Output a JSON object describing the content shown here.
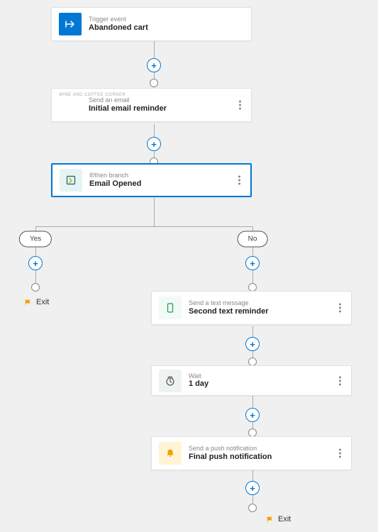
{
  "steps": {
    "trigger": {
      "type": "Trigger event",
      "name": "Abandoned cart"
    },
    "email": {
      "type": "Send an email",
      "name": "Initial email reminder",
      "badge": "WINE AND COFFEE CORNER"
    },
    "branch": {
      "type": "If/then branch",
      "name": "Email Opened"
    },
    "sms": {
      "type": "Send a text message",
      "name": "Second text reminder"
    },
    "wait": {
      "type": "Wait",
      "name": "1 day"
    },
    "push": {
      "type": "Send a push notification",
      "name": "Final push notification"
    }
  },
  "branch": {
    "yes": "Yes",
    "no": "No"
  },
  "labels": {
    "exit": "Exit"
  },
  "chart_data": {
    "type": "flow",
    "nodes": [
      {
        "id": "trigger",
        "kind": "trigger",
        "label": "Abandoned cart",
        "subtype": "Trigger event"
      },
      {
        "id": "email",
        "kind": "action",
        "label": "Initial email reminder",
        "subtype": "Send an email"
      },
      {
        "id": "branch",
        "kind": "condition",
        "label": "Email Opened",
        "subtype": "If/then branch",
        "selected": true
      },
      {
        "id": "exit_yes",
        "kind": "exit",
        "label": "Exit"
      },
      {
        "id": "sms",
        "kind": "action",
        "label": "Second text reminder",
        "subtype": "Send a text message"
      },
      {
        "id": "wait",
        "kind": "delay",
        "label": "1 day",
        "subtype": "Wait"
      },
      {
        "id": "push",
        "kind": "action",
        "label": "Final push notification",
        "subtype": "Send a push notification"
      },
      {
        "id": "exit_no",
        "kind": "exit",
        "label": "Exit"
      }
    ],
    "edges": [
      {
        "from": "trigger",
        "to": "email"
      },
      {
        "from": "email",
        "to": "branch"
      },
      {
        "from": "branch",
        "to": "exit_yes",
        "label": "Yes"
      },
      {
        "from": "branch",
        "to": "sms",
        "label": "No"
      },
      {
        "from": "sms",
        "to": "wait"
      },
      {
        "from": "wait",
        "to": "push"
      },
      {
        "from": "push",
        "to": "exit_no"
      }
    ]
  }
}
